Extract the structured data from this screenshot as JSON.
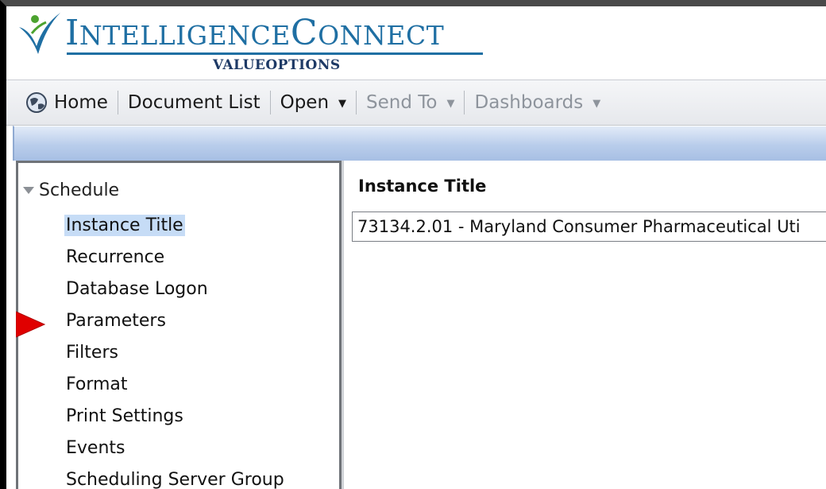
{
  "brand": {
    "name_parts": {
      "first_cap": "I",
      "first_rest": "NTELLIGENCE",
      "second_cap": "C",
      "second_rest": "ONNECT"
    },
    "subtitle": "VALUEOPTIONS",
    "colors": {
      "blue": "#1f6fa3",
      "green": "#4ca32f",
      "navy": "#1e3a66"
    }
  },
  "toolbar": {
    "items": [
      {
        "label": "Home",
        "icon": "home-globe-icon",
        "enabled": true
      },
      {
        "label": "Document List",
        "enabled": true
      },
      {
        "label": "Open",
        "enabled": true,
        "has_menu": true
      },
      {
        "label": "Send To",
        "enabled": false,
        "has_menu": true
      },
      {
        "label": "Dashboards",
        "enabled": false,
        "has_menu": true
      }
    ]
  },
  "nav": {
    "root_label": "Schedule",
    "items": [
      {
        "label": "Instance Title",
        "selected": true
      },
      {
        "label": "Recurrence"
      },
      {
        "label": "Database Logon"
      },
      {
        "label": "Parameters",
        "pointer": true
      },
      {
        "label": "Filters"
      },
      {
        "label": "Format"
      },
      {
        "label": "Print Settings"
      },
      {
        "label": "Events"
      },
      {
        "label": "Scheduling Server Group"
      }
    ]
  },
  "content": {
    "heading": "Instance Title",
    "instance_title_value": "73134.2.01 - Maryland Consumer Pharmaceutical Uti"
  },
  "colors": {
    "selection": "#c6dcf6",
    "pointer": "#e00000",
    "strip": "#b9cdeb"
  }
}
